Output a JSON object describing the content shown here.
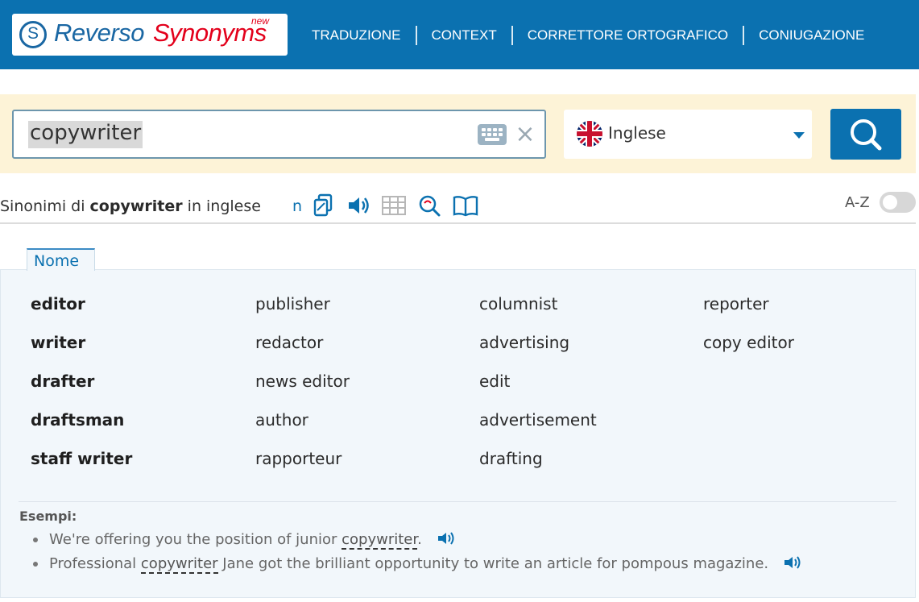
{
  "header": {
    "logo": {
      "brand": "Reverso",
      "product": "Synonyms",
      "badge": "new"
    },
    "nav": [
      "TRADUZIONE",
      "CONTEXT",
      "CORRETTORE ORTOGRAFICO",
      "CONIUGAZIONE"
    ],
    "colors": {
      "bar": "#0b71b0",
      "brand_blue": "#1a67a3",
      "brand_red": "#e3001b"
    }
  },
  "search": {
    "value": "copywriter",
    "keyboard_icon": "keyboard-icon",
    "clear_icon": "close-icon",
    "language": "Inglese",
    "button_icon": "search-icon"
  },
  "toolbar": {
    "title_prefix": "Sinonimi di ",
    "title_word": "copywriter",
    "title_suffix": " in inglese",
    "n_label": "n",
    "icons": [
      "copy-icon",
      "speaker-icon",
      "table-icon",
      "search-zoom-icon",
      "book-icon"
    ],
    "az_label": "A-Z",
    "az_enabled": false
  },
  "tabs": [
    {
      "label": "Nome",
      "active": true
    }
  ],
  "synonyms": {
    "columns": [
      [
        {
          "word": "editor",
          "strong": true
        },
        {
          "word": "writer",
          "strong": true
        },
        {
          "word": "drafter",
          "strong": true
        },
        {
          "word": "draftsman",
          "strong": true
        },
        {
          "word": "staff writer",
          "strong": true
        }
      ],
      [
        {
          "word": "publisher",
          "strong": false
        },
        {
          "word": "redactor",
          "strong": false
        },
        {
          "word": "news editor",
          "strong": false
        },
        {
          "word": "author",
          "strong": false
        },
        {
          "word": "rapporteur",
          "strong": false
        }
      ],
      [
        {
          "word": "columnist",
          "strong": false
        },
        {
          "word": "advertising",
          "strong": false
        },
        {
          "word": "edit",
          "strong": false
        },
        {
          "word": "advertisement",
          "strong": false
        },
        {
          "word": "drafting",
          "strong": false
        }
      ],
      [
        {
          "word": "reporter",
          "strong": false
        },
        {
          "word": "copy editor",
          "strong": false
        }
      ]
    ]
  },
  "examples": {
    "title": "Esempi:",
    "items": [
      {
        "before": "We're offering you the position of junior ",
        "highlight": "copywriter",
        "after": "."
      },
      {
        "before": "Professional ",
        "highlight": "copywriter",
        "after": " Jane got the brilliant opportunity to write an article for pompous magazine."
      }
    ]
  }
}
